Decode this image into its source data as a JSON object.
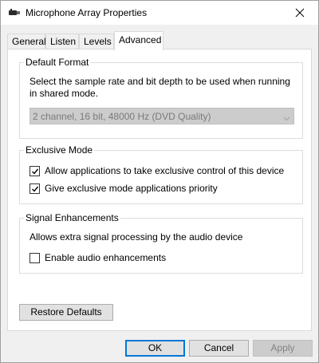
{
  "window": {
    "title": "Microphone Array Properties",
    "icon": "microphone-icon",
    "close_icon": "close-icon"
  },
  "tabs": [
    {
      "label": "General",
      "selected": false
    },
    {
      "label": "Listen",
      "selected": false
    },
    {
      "label": "Levels",
      "selected": false
    },
    {
      "label": "Advanced",
      "selected": true
    }
  ],
  "default_format": {
    "label": "Default Format",
    "description_line1": "Select the sample rate and bit depth to be used when running",
    "description_line2": "in shared mode.",
    "selected_value": "2 channel, 16 bit, 48000 Hz (DVD Quality)",
    "disabled": true
  },
  "exclusive_mode": {
    "label": "Exclusive Mode",
    "options": [
      {
        "label": "Allow applications to take exclusive control of this device",
        "checked": true
      },
      {
        "label": "Give exclusive mode applications priority",
        "checked": true
      }
    ]
  },
  "signal_enhancements": {
    "label": "Signal Enhancements",
    "description": "Allows extra signal processing by the audio device",
    "option": {
      "label": "Enable audio enhancements",
      "checked": false
    }
  },
  "buttons": {
    "restore_defaults": "Restore Defaults",
    "ok": "OK",
    "cancel": "Cancel",
    "apply": "Apply"
  },
  "colors": {
    "window_bg": "#f0f0f0",
    "panel_bg": "#ffffff",
    "focus_blue": "#0078d7",
    "disabled_bg": "#cccccc"
  }
}
